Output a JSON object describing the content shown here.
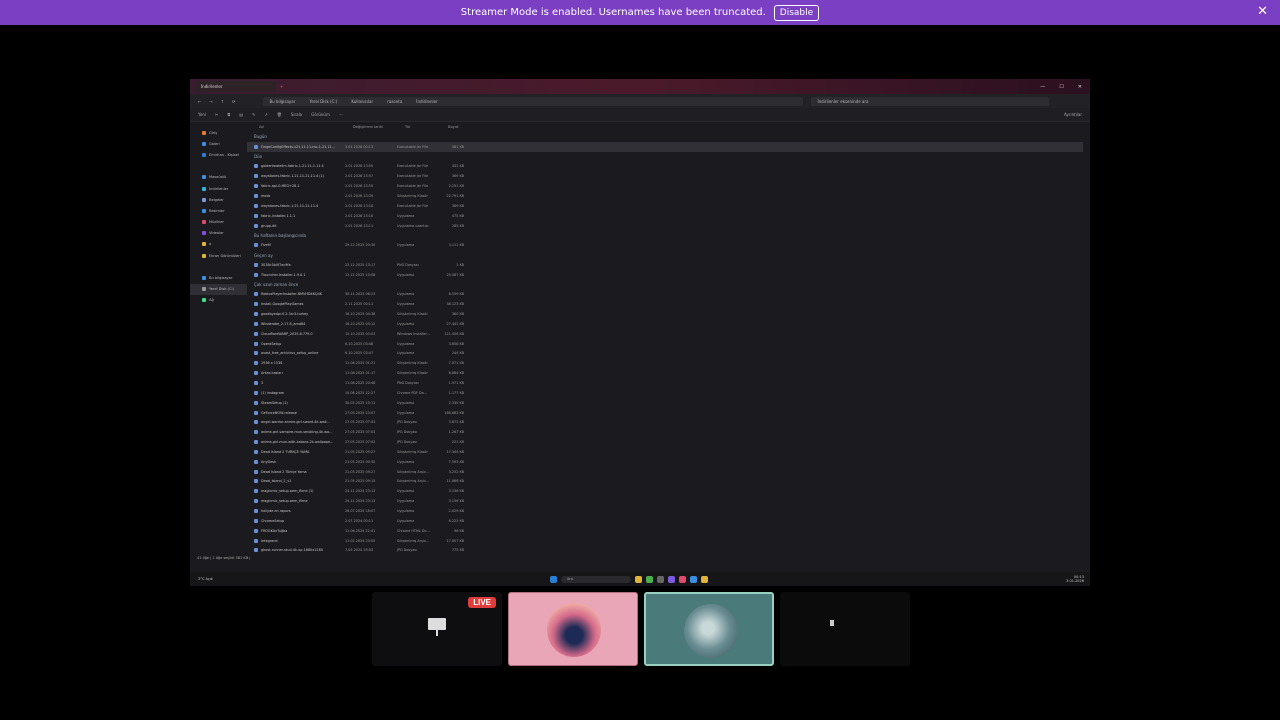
{
  "banner": {
    "message": "Streamer Mode is enabled. Usernames have been truncated.",
    "disable_label": "Disable",
    "close_glyph": "✕"
  },
  "explorer": {
    "tab_title": "İndirilenler",
    "new_tab": "+",
    "breadcrumb": [
      "Bu bilgisayar",
      "Yerel Disk (C:)",
      "Kullanıcılar",
      "rasonta",
      "İndirilenler"
    ],
    "search_placeholder": "İndirilenler ekseninde ara",
    "toolbar": [
      "Yeni",
      "Sırala",
      "Görünüm",
      "···"
    ],
    "details_label": "Ayrıntılar",
    "columns": [
      "Ad",
      "Değiştirme tarihi",
      "Tür",
      "Boyut"
    ],
    "sidebar": [
      {
        "label": "Giriş",
        "color": "#e07b3a"
      },
      {
        "label": "Galeri",
        "color": "#3a8fe0"
      },
      {
        "label": "Emirhan - Kişisel",
        "color": "#2e7bd6"
      },
      {
        "label": "",
        "color": ""
      },
      {
        "label": "Masaüstü",
        "color": "#3a8fe0"
      },
      {
        "label": "İndirilenler",
        "color": "#3ab0e0"
      },
      {
        "label": "Belgeler",
        "color": "#7a9ad6"
      },
      {
        "label": "Resimler",
        "color": "#3a8fe0"
      },
      {
        "label": "Müzikler",
        "color": "#e04a6a"
      },
      {
        "label": "Videolar",
        "color": "#8a4ae0"
      },
      {
        "label": "a",
        "color": "#e0b33a"
      },
      {
        "label": "Ekran Görüntüleri",
        "color": "#e0b33a"
      },
      {
        "label": "",
        "color": ""
      },
      {
        "label": "Bu bilgisayar",
        "color": "#3a8fe0"
      },
      {
        "label": "Yerel Disk (C:)",
        "color": "#999999"
      },
      {
        "label": "Ağ",
        "color": "#3ae08a"
      }
    ],
    "groups": [
      {
        "label": "Bugün",
        "rows": [
          {
            "name": "ForgeConfigEffects-v21.11.11-mc-1.21.11...",
            "date": "3.01.2026 00:13",
            "type": "Executable Jar File",
            "size": "581 KB",
            "selected": true
          }
        ]
      },
      {
        "label": "Dün",
        "rows": [
          {
            "name": "goldenteatelim-fabric-1.21.11-1.11.4",
            "date": "2.01.2026 23:59",
            "type": "Executable Jar File",
            "size": "452 KB"
          },
          {
            "name": "waystones-fabric-1.21.11-21.11.4 (1)",
            "date": "2.01.2026 23:57",
            "type": "Executable Jar File",
            "size": "369 KB"
          },
          {
            "name": "fabric-api-0.MEG+26.1",
            "date": "2.01.2026 23:55",
            "type": "Executable Jar File",
            "size": "2.251 KB"
          },
          {
            "name": "mods",
            "date": "2.01.2026 23:39",
            "type": "Sıkıştırılmış Klasör",
            "size": "22.791 KB"
          },
          {
            "name": "waystones-fabric-1.21.11-21.11.4",
            "date": "2.01.2026 23:18",
            "type": "Executable Jar File",
            "size": "369 KB"
          },
          {
            "name": "fabric-installer-1.1.1",
            "date": "2.01.2026 23:16",
            "type": "Uygulama",
            "size": "475 KB"
          },
          {
            "name": "grupp.dit",
            "date": "2.01.2026 23:11",
            "type": "Uygulama uzantısı",
            "size": "285 KB"
          }
        ]
      },
      {
        "label": "Bu haftanın başlangıcında",
        "rows": [
          {
            "name": "FiveM",
            "date": "29.12.2025 20:30",
            "type": "Uygulama",
            "size": "3.111 KB"
          }
        ]
      },
      {
        "label": "Geçen ay",
        "rows": [
          {
            "name": "3038c3b4f7ec9fa",
            "date": "22.12.2025 13:17",
            "type": "PNG Dosyası",
            "size": "1 KB"
          },
          {
            "name": "Tlauncher-Installer-1.9.0.1",
            "date": "12.12.2025 13:08",
            "type": "Uygulama",
            "size": "25.087 KB"
          }
        ]
      },
      {
        "label": "Çok uzun zaman önce",
        "rows": [
          {
            "name": "RobloxPlayerInstaller-NMVHD4KQ4K",
            "date": "30.11.2025 06:23",
            "type": "Uygulama",
            "size": "6.559 KB"
          },
          {
            "name": "Install-GooglePlayGames",
            "date": "2.11.2025 00:11",
            "type": "Uygulama",
            "size": "38.123 KB"
          },
          {
            "name": "goodbyedpi-0.2.3rc3-turkey",
            "date": "16.10.2025 04:38",
            "type": "Sıkıştırılmış Klasör",
            "size": "360 KB"
          },
          {
            "name": "Winderobe_2.17.6_amd64",
            "date": "16.10.2025 03:12",
            "type": "Uygulama",
            "size": "27.442 KB"
          },
          {
            "name": "CloudflareWARP_2025.6.779.0",
            "date": "15.10.2025 03:03",
            "type": "Windows Installer...",
            "size": "121.456 KB"
          },
          {
            "name": "OperaSetup",
            "date": "6.10.2025 03:48",
            "type": "Uygulama",
            "size": "3.658 KB"
          },
          {
            "name": "avast_free_antivirus_setup_online",
            "date": "6.10.2025 03:47",
            "type": "Uygulama",
            "size": "244 KB"
          },
          {
            "name": "1936 x 1536",
            "date": "11.08.2025 01:21",
            "type": "Sıkıştırılmış Klasör",
            "size": "7.071 KB"
          },
          {
            "name": "Arkas kasları",
            "date": "11.08.2025 01:17",
            "type": "Sıkıştırılmış Klasör",
            "size": "6.884 KB"
          },
          {
            "name": "3",
            "date": "11.08.2025 20:46",
            "type": "PNG Dosyası",
            "size": "1.971 KB"
          },
          {
            "name": "(1) instagram",
            "date": "10.08.2025 22:27",
            "type": "Chrome PDF Do...",
            "size": "1.177 KB"
          },
          {
            "name": "SteamSetup (1)",
            "date": "30.05.2025 15:11",
            "type": "Uygulama",
            "size": "2.335 KB"
          },
          {
            "name": "GeForceNOW-release",
            "date": "27.05.2025 23:07",
            "type": "Uygulama",
            "size": "168.683 KB"
          },
          {
            "name": "angel-warrior-anime-girl-sword-4k-wall...",
            "date": "27.05.2025 07:03",
            "type": "JPG Dosyası",
            "size": "3.872 KB"
          },
          {
            "name": "anime-girl-vampire-mun-smoking-4k-wa...",
            "date": "27.05.2025 07:03",
            "type": "JPG Dosyası",
            "size": "1.267 KB"
          },
          {
            "name": "anime-girl-mun-with-katana-2k-wallpape...",
            "date": "27.05.2025 07:02",
            "type": "JPG Dosyası",
            "size": "221 KB"
          },
          {
            "name": "Dead Island 2 TÜRKÇE YAMA",
            "date": "21.05.2025 09:27",
            "type": "Sıkıştırılmış Klasör",
            "size": "17.344 KB"
          },
          {
            "name": "AnyDesk",
            "date": "21.05.2025 00:30",
            "type": "Uygulama",
            "size": "7.593 KB"
          },
          {
            "name": "Dead Island 2 Türkçe Yama",
            "date": "21.05.2025 09:27",
            "type": "Sıkıştırılmış Arşiv...",
            "size": "3.252 KB"
          },
          {
            "name": "Dead_Island_2_v2",
            "date": "21.05.2025 09:15",
            "type": "Sıkıştırılmış Arşiv...",
            "size": "11.868 KB"
          },
          {
            "name": "magicmic_setup-oem_filme (1)",
            "date": "24.11.2024 23:13",
            "type": "Uygulama",
            "size": "3.136 KB"
          },
          {
            "name": "magicmic_setup-oem_filme",
            "date": "24.11.2024 23:13",
            "type": "Uygulama",
            "size": "3.136 KB"
          },
          {
            "name": "hollyde en rapors",
            "date": "26.07.2024 18:07",
            "type": "Uygulama",
            "size": "2.029 KB"
          },
          {
            "name": "ChromeSetup",
            "date": "2.07.2024 00:11",
            "type": "Uygulama",
            "size": "6.223 KB"
          },
          {
            "name": "FROGKAnTuğba",
            "date": "11.06.2024 22:41",
            "type": "Chrome HTML Do...",
            "size": "96 KB"
          },
          {
            "name": "Integrand",
            "date": "11.02.2024 23:05",
            "type": "Sıkıştırılmış Arşiv...",
            "size": "17.007 KB"
          },
          {
            "name": "ghost-runner-skull-4k-xp-1680x1280",
            "date": "7.05.2024 19:03",
            "type": "JPG Dosyası",
            "size": "775 KB"
          }
        ]
      }
    ],
    "status": "41 öğe   |   1 öğe seçildi  581 KB  |"
  },
  "taskbar": {
    "weather": "3°C",
    "weather_sub": "Açık",
    "search": "Ara",
    "time": "00:13",
    "date": "3.01.2026"
  },
  "stream_tiles": {
    "live_label": "LIVE"
  }
}
